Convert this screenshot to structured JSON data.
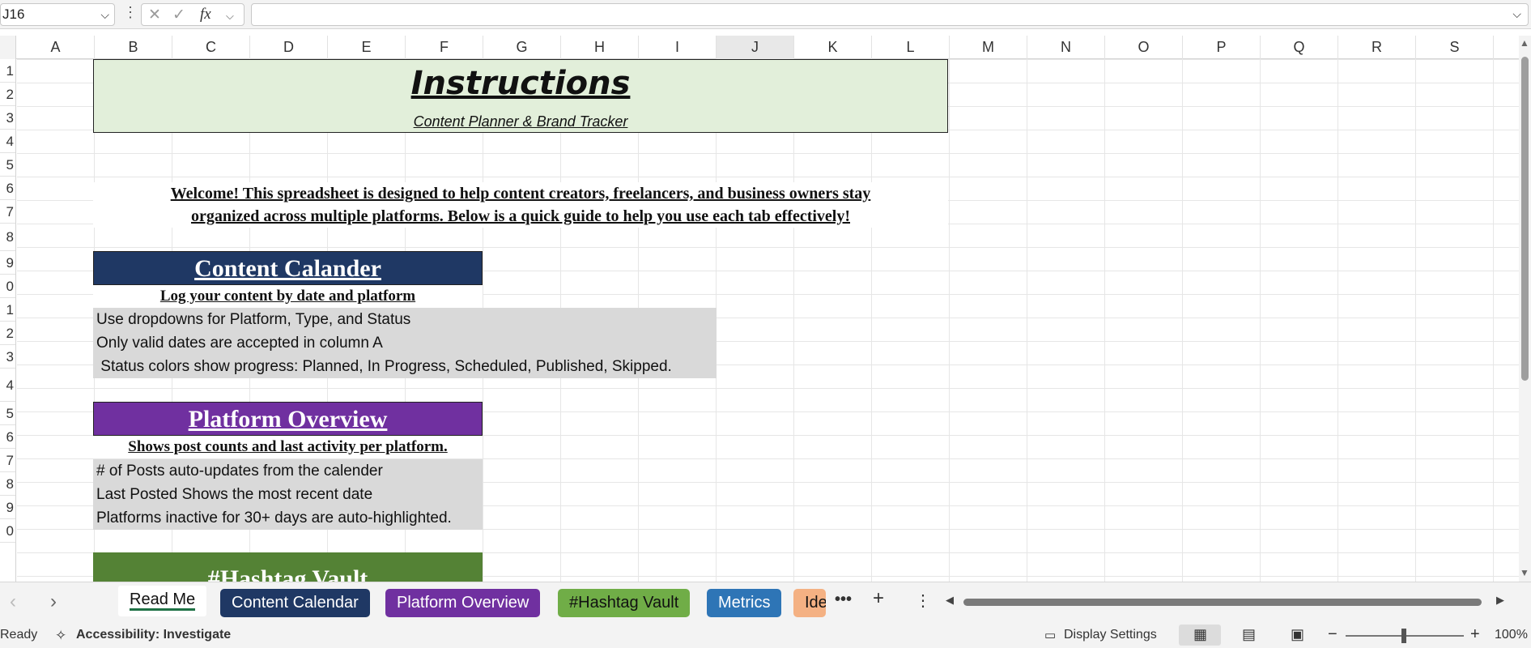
{
  "formula_bar": {
    "name_box": "J16",
    "fx_label": "fx",
    "formula": ""
  },
  "columns": [
    "A",
    "B",
    "C",
    "D",
    "E",
    "F",
    "G",
    "H",
    "I",
    "J",
    "K",
    "L",
    "M",
    "N",
    "O",
    "P",
    "Q",
    "R",
    "S"
  ],
  "rows": [
    "1",
    "2",
    "3",
    "4",
    "5",
    "6",
    "7",
    "8",
    "9",
    "0",
    "1",
    "2",
    "3",
    "4",
    "5",
    "6",
    "7",
    "8",
    "9",
    "0"
  ],
  "instructions": {
    "title": "Instructions",
    "subtitle": "Content Planner & Brand Tracker",
    "welcome_line1": "Welcome! This spreadsheet is designed to help content creators, freelancers, and business owners stay",
    "welcome_line2": "organized across multiple platforms. Below is a quick guide to help you use each tab effectively!"
  },
  "sections": {
    "content_calendar": {
      "heading": "Content Calander",
      "subheading": "Log your content by date and platform",
      "lines": [
        "Use dropdowns for Platform, Type, and Status",
        "Only valid dates are accepted in column A",
        " Status colors show progress: Planned, In Progress, Scheduled, Published, Skipped."
      ],
      "color": "#1f3864"
    },
    "platform_overview": {
      "heading": "Platform Overview",
      "subheading": "Shows post counts and last activity per platform. ",
      "lines": [
        "# of Posts auto-updates from the calender",
        "Last Posted Shows the most recent date",
        "Platforms inactive for 30+ days are auto-highlighted."
      ],
      "color": "#7030a0"
    },
    "hashtag_vault": {
      "heading": "#Hashtag Vault",
      "color": "#548235"
    }
  },
  "sheet_tabs": [
    {
      "label": "Read Me",
      "color": "#ffffff",
      "text_color": "#111111",
      "active": true
    },
    {
      "label": "Content Calendar",
      "color": "#1f3864",
      "text_color": "#ffffff"
    },
    {
      "label": "Platform Overview",
      "color": "#7030a0",
      "text_color": "#ffffff"
    },
    {
      "label": "#Hashtag Vault",
      "color": "#70ad47",
      "text_color": "#111111"
    },
    {
      "label": "Metrics",
      "color": "#2e75b6",
      "text_color": "#ffffff"
    },
    {
      "label": "Ide",
      "color": "#f4b183",
      "text_color": "#111111"
    }
  ],
  "status_bar": {
    "ready": "Ready",
    "accessibility": "Accessibility: Investigate",
    "display_settings": "Display Settings",
    "zoom": "100%"
  }
}
